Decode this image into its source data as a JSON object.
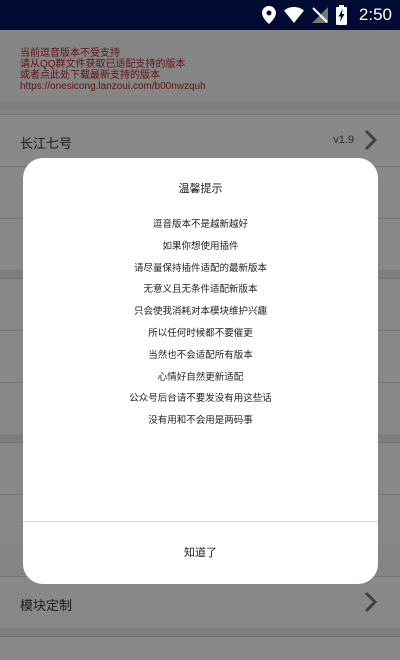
{
  "status_bar": {
    "time": "2:50"
  },
  "notice": {
    "lines": [
      "当前逗音版本不受支持",
      "请从QQ群文件获取已适配支持的版本",
      "或者点此处下载最新支持的版本",
      "https://onesicong.lanzoui.com/b00nwzquh"
    ]
  },
  "list": {
    "version_row": {
      "label": "长江七号",
      "version": "v1.9"
    },
    "module_row": {
      "label": "模块定制"
    }
  },
  "dialog": {
    "title": "温馨提示",
    "lines": [
      "逗音版本不是越新越好",
      "如果你想使用插件",
      "请尽量保持插件适配的最新版本",
      "无意义且无条件适配新版本",
      "只会使我消耗对本模块维护兴趣",
      "所以任何时候都不要催更",
      "当然也不会适配所有版本",
      "心情好自然更新适配",
      "公众号后台请不要发没有用这些话",
      "没有用和不会用是两码事"
    ],
    "confirm_label": "知道了"
  }
}
